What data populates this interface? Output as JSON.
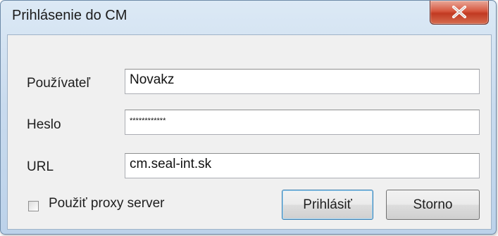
{
  "window": {
    "title": "Prihlásenie do CM",
    "close_glyph": "x"
  },
  "form": {
    "user_label": "Používateľ",
    "user_value": "Novakz",
    "password_label": "Heslo",
    "password_value": "************",
    "url_label": "URL",
    "url_value": "cm.seal-int.sk"
  },
  "proxy": {
    "label": "Použiť proxy server",
    "checked": false
  },
  "buttons": {
    "login_label": "Prihlásiť",
    "cancel_label": "Storno"
  },
  "colors": {
    "close_button": "#c13a22",
    "title_background": "#c9dbee",
    "client_background": "#f0f0f0"
  }
}
